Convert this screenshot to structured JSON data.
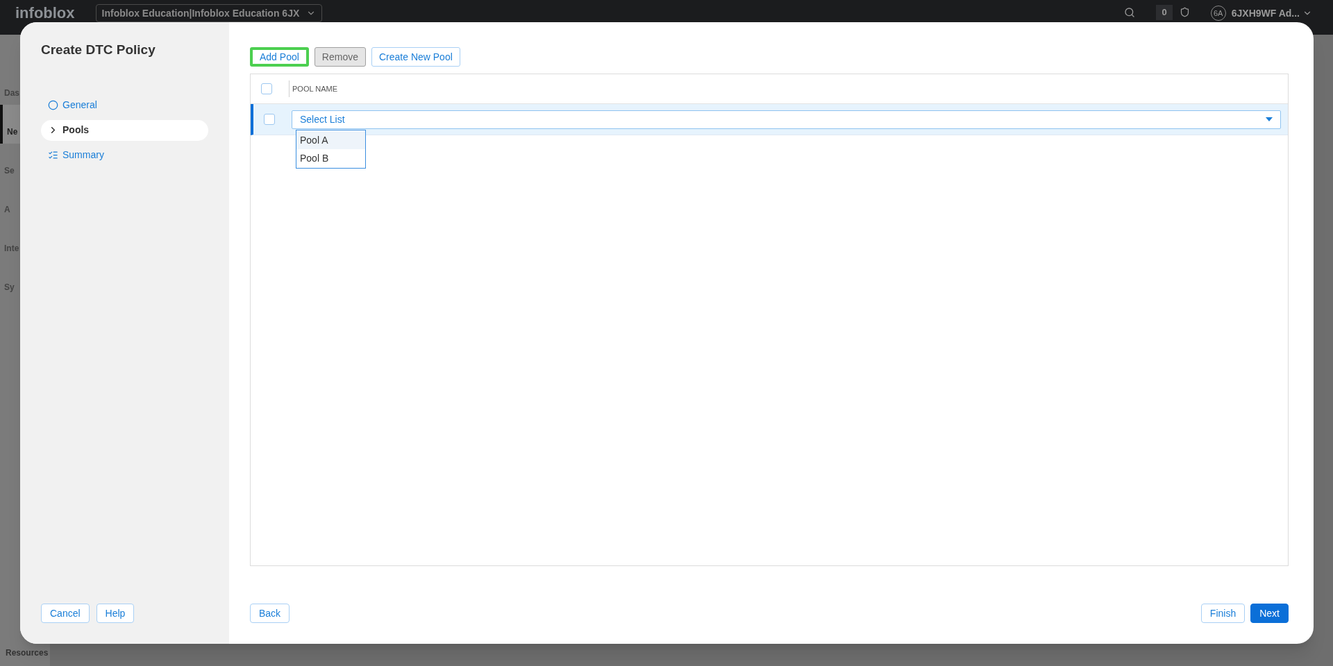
{
  "app_bar": {
    "logo": "infoblox",
    "account_selector": "Infoblox Education|Infoblox Education 6JX",
    "count": "0",
    "avatar": "6A",
    "user": "6JXH9WF Ad..."
  },
  "side_nav": [
    {
      "label": "Das",
      "selected": false
    },
    {
      "label": "Ne",
      "selected": true
    },
    {
      "label": "Se",
      "selected": false
    },
    {
      "label": "A",
      "selected": false
    },
    {
      "label": "Inte",
      "selected": false
    },
    {
      "label": "Sy",
      "selected": false
    }
  ],
  "side_nav_footer": "Resources",
  "dialog": {
    "title": "Create DTC Policy",
    "steps": [
      {
        "label": "General",
        "kind": "circle",
        "selected": false
      },
      {
        "label": "Pools",
        "kind": "chevron",
        "selected": true
      },
      {
        "label": "Summary",
        "kind": "list",
        "selected": false
      }
    ],
    "toolbar": [
      {
        "label": "Add Pool",
        "disabled": false,
        "highlighted": true
      },
      {
        "label": "Remove",
        "disabled": true,
        "highlighted": false
      },
      {
        "label": "Create New Pool",
        "disabled": false,
        "highlighted": false
      }
    ],
    "table": {
      "columns": [
        "POOL NAME"
      ],
      "header_checked": false,
      "rows": [
        {
          "checked": false,
          "selected": true,
          "placeholder": "Select List",
          "options": [
            {
              "label": "Pool A",
              "selected": true
            },
            {
              "label": "Pool B",
              "selected": false
            }
          ]
        }
      ]
    },
    "left_buttons": [
      "Cancel",
      "Help"
    ],
    "back_button": "Back",
    "right_buttons": [
      {
        "label": "Finish",
        "primary": false
      },
      {
        "label": "Next",
        "primary": true
      }
    ]
  }
}
